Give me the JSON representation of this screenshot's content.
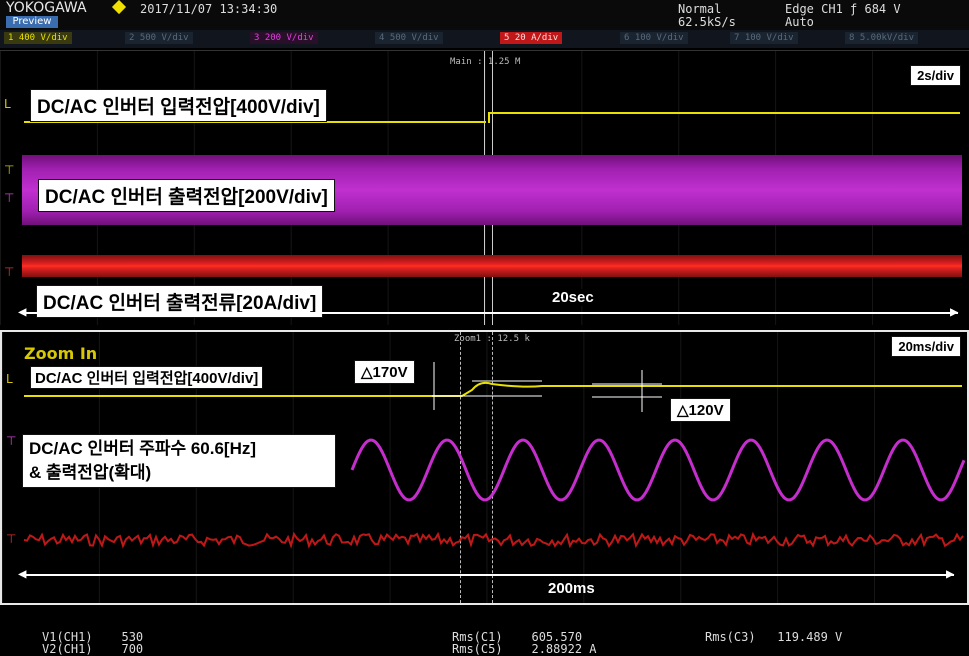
{
  "header": {
    "brand": "YOKOGAWA",
    "preview": "Preview",
    "datetime": "2017/11/07  13:34:30",
    "acq_mode": "Normal",
    "sample_rate": "62.5kS/s",
    "trigger": "Edge CH1 ƒ 684 V",
    "trigger_mode": "Auto"
  },
  "channel_bar": [
    {
      "label": "1  400 V/div",
      "color": "#e8e000"
    },
    {
      "label": "2  500 V/div",
      "color": "#5a6a7a"
    },
    {
      "label": "3  200 V/div",
      "color": "#e040e0"
    },
    {
      "label": "4  500 V/div",
      "color": "#5a6a7a"
    },
    {
      "label": "5  20 A/div",
      "color": "#e02020"
    },
    {
      "label": "6  100 V/div",
      "color": "#5a6a7a"
    },
    {
      "label": "7  100 V/div",
      "color": "#5a6a7a"
    },
    {
      "label": "8  5.00kV/div",
      "color": "#5a6a7a"
    }
  ],
  "main_view": {
    "marker": "Main : 1.25 M",
    "timebase": "2s/div",
    "label_input": "DC/AC 인버터 입력전압[400V/div]",
    "label_output_v": "DC/AC 인버터 출력전압[200V/div]",
    "label_output_i": "DC/AC 인버터 출력전류[20A/div]",
    "span": "20sec"
  },
  "zoom_view": {
    "marker": "Zoom1 : 12.5 k",
    "title": "Zoom In",
    "timebase": "20ms/div",
    "label_input": "DC/AC 인버터 입력전압[400V/div]",
    "label_freq_line1": "DC/AC 인버터 주파수 60.6[Hz]",
    "label_freq_line2": "& 출력전압(확대)",
    "delta_1": "△170V",
    "delta_2": "△120V",
    "span": "200ms"
  },
  "footer": {
    "v1": "V1(CH1)    530",
    "v2": "V2(CH1)    700",
    "rms_c1": "Rms(C1)    605.570",
    "rms_c5": "Rms(C5)    2.88922 A",
    "rms_c3": "Rms(C3)   119.489 V"
  },
  "colors": {
    "ch1": "#e8e000",
    "ch3": "#d030d8",
    "ch5": "#e01818"
  }
}
